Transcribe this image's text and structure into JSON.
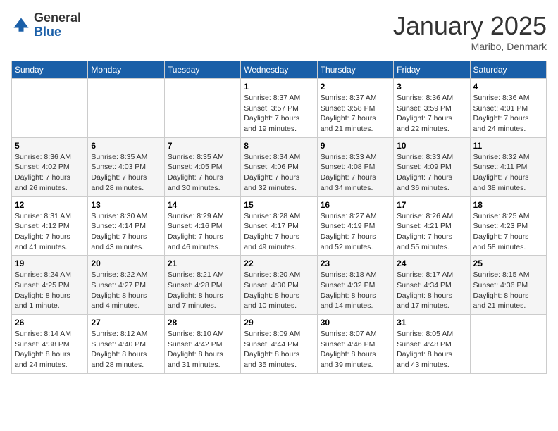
{
  "header": {
    "logo_general": "General",
    "logo_blue": "Blue",
    "month_title": "January 2025",
    "location": "Maribo, Denmark"
  },
  "weekdays": [
    "Sunday",
    "Monday",
    "Tuesday",
    "Wednesday",
    "Thursday",
    "Friday",
    "Saturday"
  ],
  "weeks": [
    [
      {
        "day": "",
        "info": ""
      },
      {
        "day": "",
        "info": ""
      },
      {
        "day": "",
        "info": ""
      },
      {
        "day": "1",
        "info": "Sunrise: 8:37 AM\nSunset: 3:57 PM\nDaylight: 7 hours\nand 19 minutes."
      },
      {
        "day": "2",
        "info": "Sunrise: 8:37 AM\nSunset: 3:58 PM\nDaylight: 7 hours\nand 21 minutes."
      },
      {
        "day": "3",
        "info": "Sunrise: 8:36 AM\nSunset: 3:59 PM\nDaylight: 7 hours\nand 22 minutes."
      },
      {
        "day": "4",
        "info": "Sunrise: 8:36 AM\nSunset: 4:01 PM\nDaylight: 7 hours\nand 24 minutes."
      }
    ],
    [
      {
        "day": "5",
        "info": "Sunrise: 8:36 AM\nSunset: 4:02 PM\nDaylight: 7 hours\nand 26 minutes."
      },
      {
        "day": "6",
        "info": "Sunrise: 8:35 AM\nSunset: 4:03 PM\nDaylight: 7 hours\nand 28 minutes."
      },
      {
        "day": "7",
        "info": "Sunrise: 8:35 AM\nSunset: 4:05 PM\nDaylight: 7 hours\nand 30 minutes."
      },
      {
        "day": "8",
        "info": "Sunrise: 8:34 AM\nSunset: 4:06 PM\nDaylight: 7 hours\nand 32 minutes."
      },
      {
        "day": "9",
        "info": "Sunrise: 8:33 AM\nSunset: 4:08 PM\nDaylight: 7 hours\nand 34 minutes."
      },
      {
        "day": "10",
        "info": "Sunrise: 8:33 AM\nSunset: 4:09 PM\nDaylight: 7 hours\nand 36 minutes."
      },
      {
        "day": "11",
        "info": "Sunrise: 8:32 AM\nSunset: 4:11 PM\nDaylight: 7 hours\nand 38 minutes."
      }
    ],
    [
      {
        "day": "12",
        "info": "Sunrise: 8:31 AM\nSunset: 4:12 PM\nDaylight: 7 hours\nand 41 minutes."
      },
      {
        "day": "13",
        "info": "Sunrise: 8:30 AM\nSunset: 4:14 PM\nDaylight: 7 hours\nand 43 minutes."
      },
      {
        "day": "14",
        "info": "Sunrise: 8:29 AM\nSunset: 4:16 PM\nDaylight: 7 hours\nand 46 minutes."
      },
      {
        "day": "15",
        "info": "Sunrise: 8:28 AM\nSunset: 4:17 PM\nDaylight: 7 hours\nand 49 minutes."
      },
      {
        "day": "16",
        "info": "Sunrise: 8:27 AM\nSunset: 4:19 PM\nDaylight: 7 hours\nand 52 minutes."
      },
      {
        "day": "17",
        "info": "Sunrise: 8:26 AM\nSunset: 4:21 PM\nDaylight: 7 hours\nand 55 minutes."
      },
      {
        "day": "18",
        "info": "Sunrise: 8:25 AM\nSunset: 4:23 PM\nDaylight: 7 hours\nand 58 minutes."
      }
    ],
    [
      {
        "day": "19",
        "info": "Sunrise: 8:24 AM\nSunset: 4:25 PM\nDaylight: 8 hours\nand 1 minute."
      },
      {
        "day": "20",
        "info": "Sunrise: 8:22 AM\nSunset: 4:27 PM\nDaylight: 8 hours\nand 4 minutes."
      },
      {
        "day": "21",
        "info": "Sunrise: 8:21 AM\nSunset: 4:28 PM\nDaylight: 8 hours\nand 7 minutes."
      },
      {
        "day": "22",
        "info": "Sunrise: 8:20 AM\nSunset: 4:30 PM\nDaylight: 8 hours\nand 10 minutes."
      },
      {
        "day": "23",
        "info": "Sunrise: 8:18 AM\nSunset: 4:32 PM\nDaylight: 8 hours\nand 14 minutes."
      },
      {
        "day": "24",
        "info": "Sunrise: 8:17 AM\nSunset: 4:34 PM\nDaylight: 8 hours\nand 17 minutes."
      },
      {
        "day": "25",
        "info": "Sunrise: 8:15 AM\nSunset: 4:36 PM\nDaylight: 8 hours\nand 21 minutes."
      }
    ],
    [
      {
        "day": "26",
        "info": "Sunrise: 8:14 AM\nSunset: 4:38 PM\nDaylight: 8 hours\nand 24 minutes."
      },
      {
        "day": "27",
        "info": "Sunrise: 8:12 AM\nSunset: 4:40 PM\nDaylight: 8 hours\nand 28 minutes."
      },
      {
        "day": "28",
        "info": "Sunrise: 8:10 AM\nSunset: 4:42 PM\nDaylight: 8 hours\nand 31 minutes."
      },
      {
        "day": "29",
        "info": "Sunrise: 8:09 AM\nSunset: 4:44 PM\nDaylight: 8 hours\nand 35 minutes."
      },
      {
        "day": "30",
        "info": "Sunrise: 8:07 AM\nSunset: 4:46 PM\nDaylight: 8 hours\nand 39 minutes."
      },
      {
        "day": "31",
        "info": "Sunrise: 8:05 AM\nSunset: 4:48 PM\nDaylight: 8 hours\nand 43 minutes."
      },
      {
        "day": "",
        "info": ""
      }
    ]
  ]
}
